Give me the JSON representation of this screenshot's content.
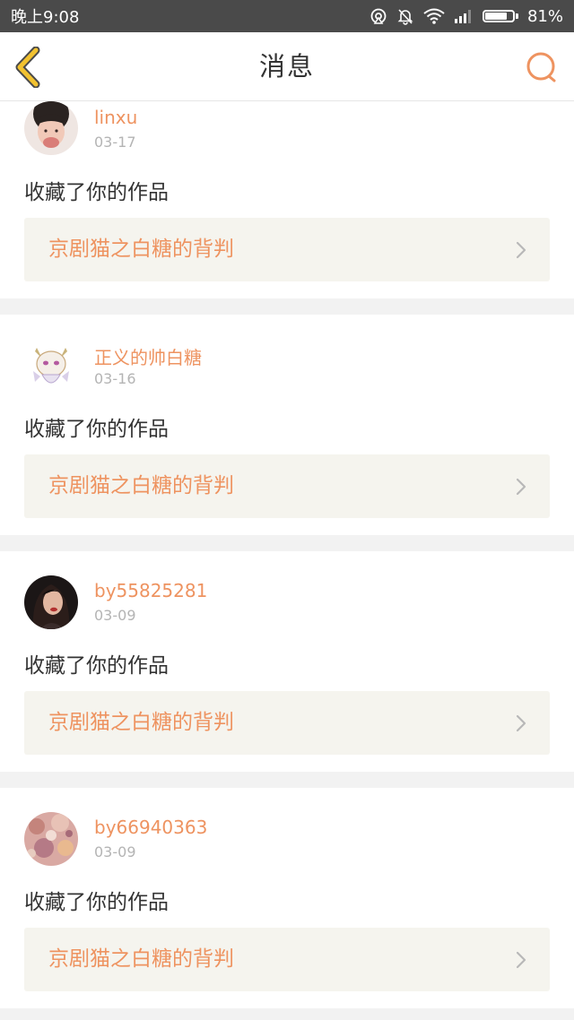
{
  "status_bar": {
    "time": "晚上9:08",
    "battery": "81%",
    "battery_level": 0.81,
    "icons": [
      "hotspot-icon",
      "notifications-off-icon",
      "wifi-icon",
      "signal-icon",
      "battery-icon"
    ]
  },
  "nav": {
    "title": "消息",
    "back_icon": "chevron-left-icon",
    "search_icon": "search-icon"
  },
  "colors": {
    "accent": "#ee9360",
    "back_arrow": "#f2c230",
    "text": "#333333",
    "muted": "#b4b4b4",
    "link_bg": "#f5f4ee",
    "page_bg": "#f2f2f2"
  },
  "messages": [
    {
      "username": "linxu",
      "date": "03-17",
      "action": "收藏了你的作品",
      "work_title": "京剧猫之白糖的背判"
    },
    {
      "username": "正义的帅白糖",
      "date": "03-16",
      "action": "收藏了你的作品",
      "work_title": "京剧猫之白糖的背判"
    },
    {
      "username": "by55825281",
      "date": "03-09",
      "action": "收藏了你的作品",
      "work_title": "京剧猫之白糖的背判"
    },
    {
      "username": "by66940363",
      "date": "03-09",
      "action": "收藏了你的作品",
      "work_title": "京剧猫之白糖的背判"
    }
  ]
}
